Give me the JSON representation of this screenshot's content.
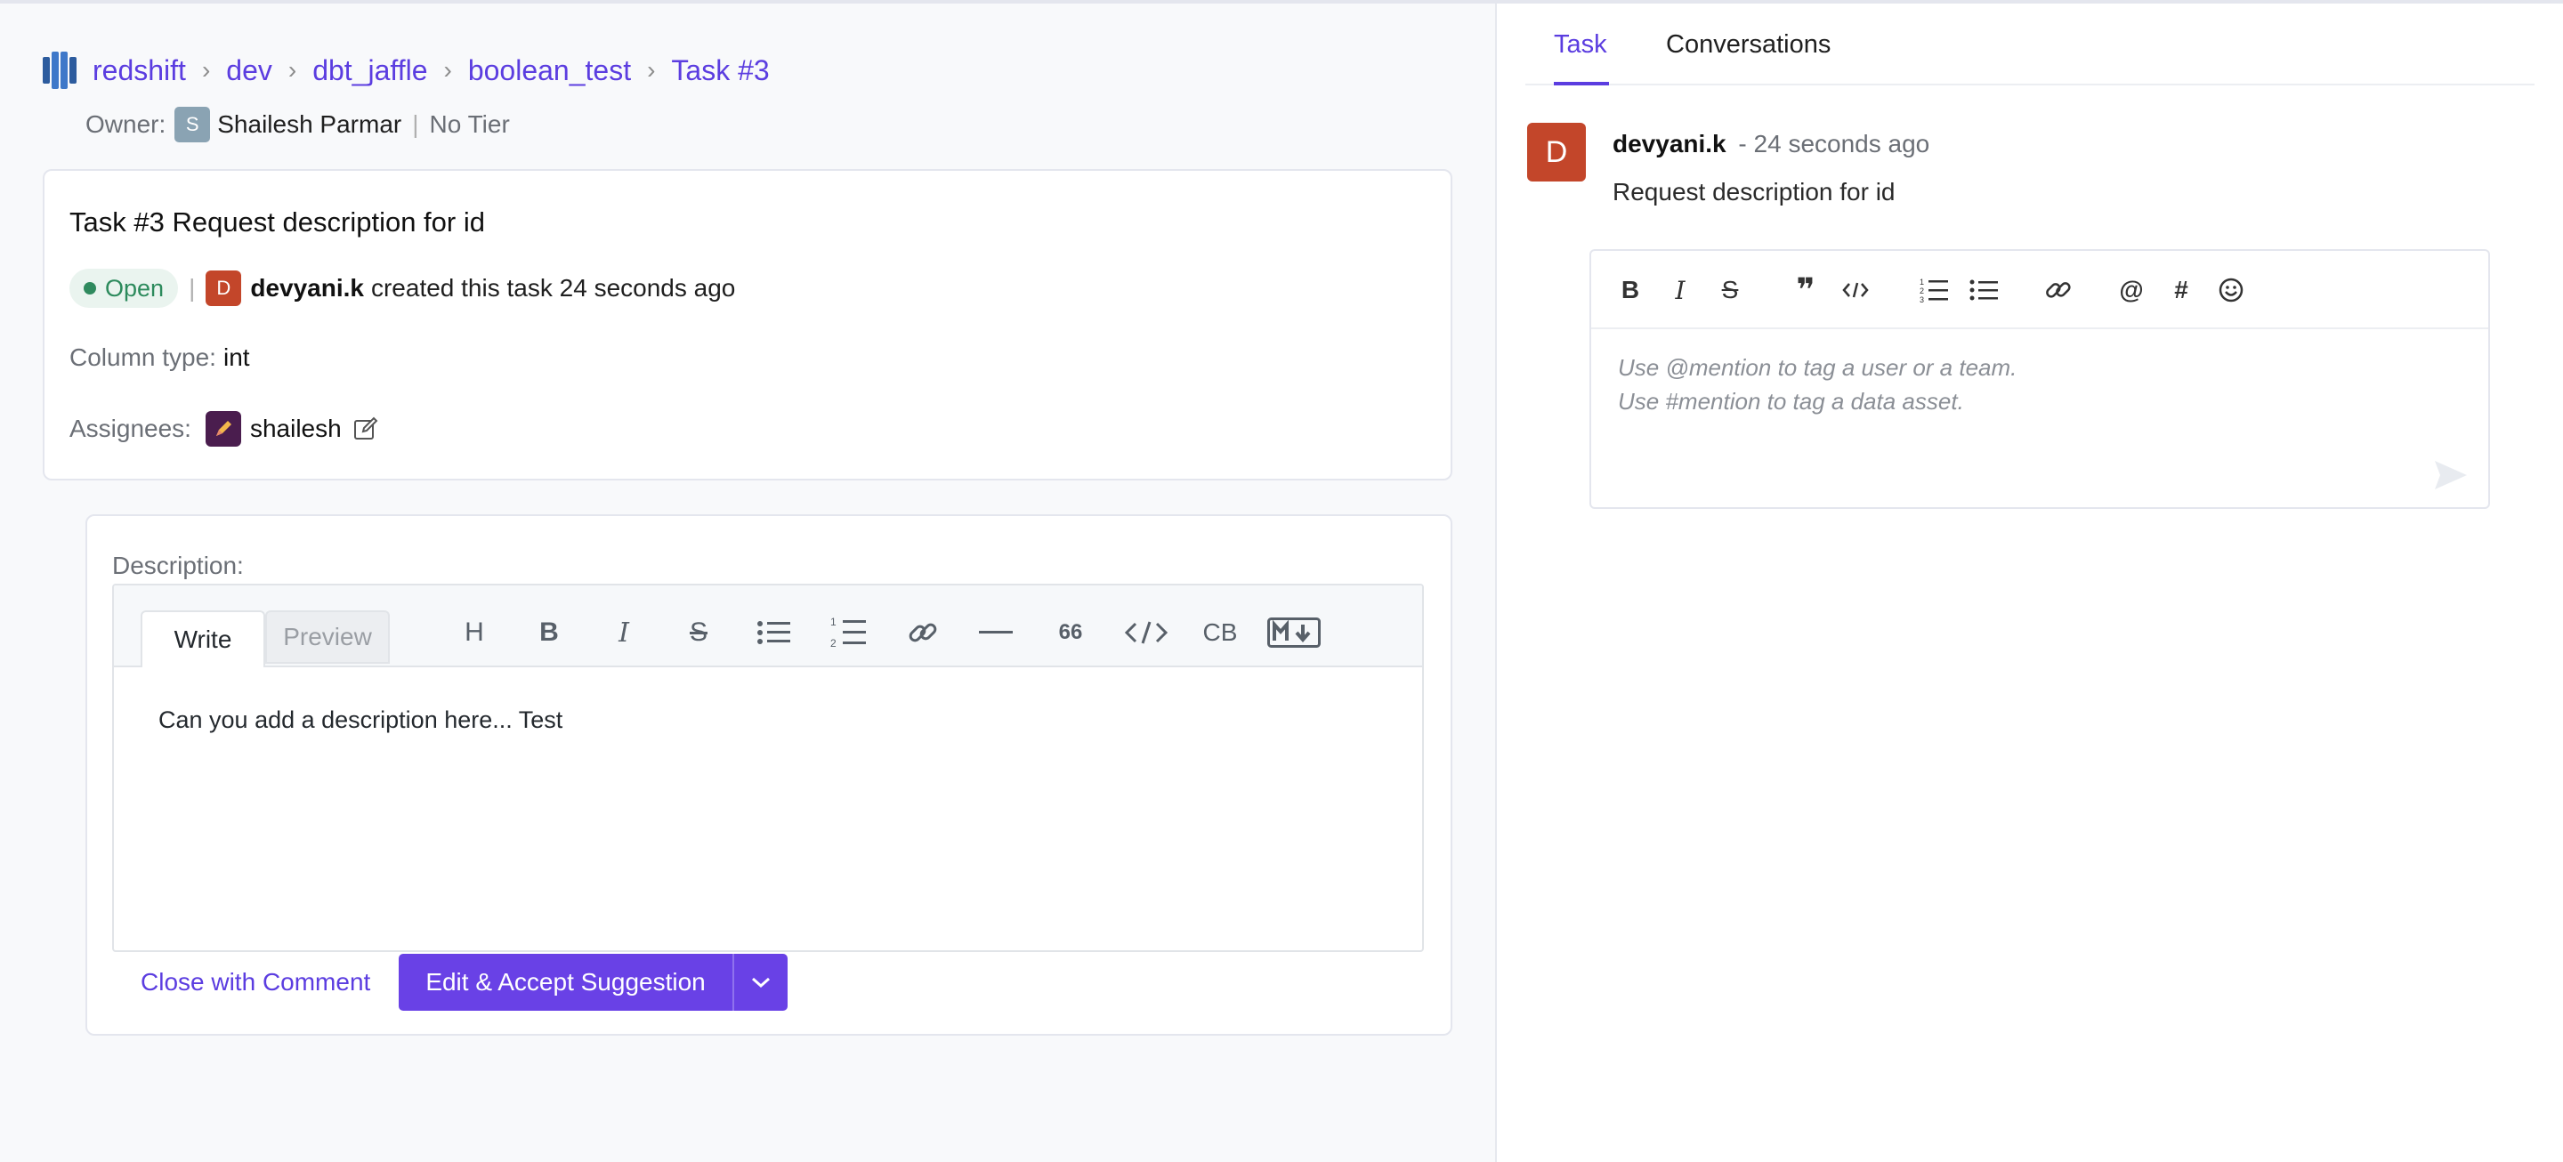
{
  "breadcrumb": {
    "items": [
      "redshift",
      "dev",
      "dbt_jaffle",
      "boolean_test",
      "Task #3"
    ],
    "separator": ">"
  },
  "owner": {
    "label": "Owner:",
    "initial": "S",
    "name": "Shailesh Parmar",
    "tier": "No Tier"
  },
  "task": {
    "title": "Task #3 Request description for id",
    "status": "Open",
    "creator_initial": "D",
    "creator": "devyani.k",
    "created_text": "created this task 24 seconds ago",
    "column_type_label": "Column type:",
    "column_type": "int",
    "assignees_label": "Assignees:",
    "assignee": "shailesh"
  },
  "description": {
    "label": "Description:",
    "tabs": {
      "write": "Write",
      "preview": "Preview"
    },
    "toolbar": {
      "heading": "H",
      "bold": "B",
      "italic": "I",
      "strike": "S",
      "quote": "66",
      "code_block": "CB"
    },
    "value": "Can you add a description here... Test",
    "close_label": "Close with Comment",
    "accept_label": "Edit & Accept Suggestion"
  },
  "panel": {
    "tabs": {
      "task": "Task",
      "conversations": "Conversations"
    },
    "message": {
      "initial": "D",
      "author": "devyani.k",
      "time": "- 24 seconds ago",
      "body": "Request description for id"
    },
    "composer": {
      "toolbar": {
        "bold": "B",
        "italic": "I",
        "strike": "S",
        "blockquote": "❞",
        "mention": "@",
        "hashtag": "#"
      },
      "placeholder_line1": "Use @mention to tag a user or a team.",
      "placeholder_line2": "Use #mention to tag a data asset."
    }
  },
  "colors": {
    "accent": "#6941e6",
    "link": "#5b3de0",
    "status_open": "#2c8a5c",
    "avatar_red": "#c3462a"
  }
}
